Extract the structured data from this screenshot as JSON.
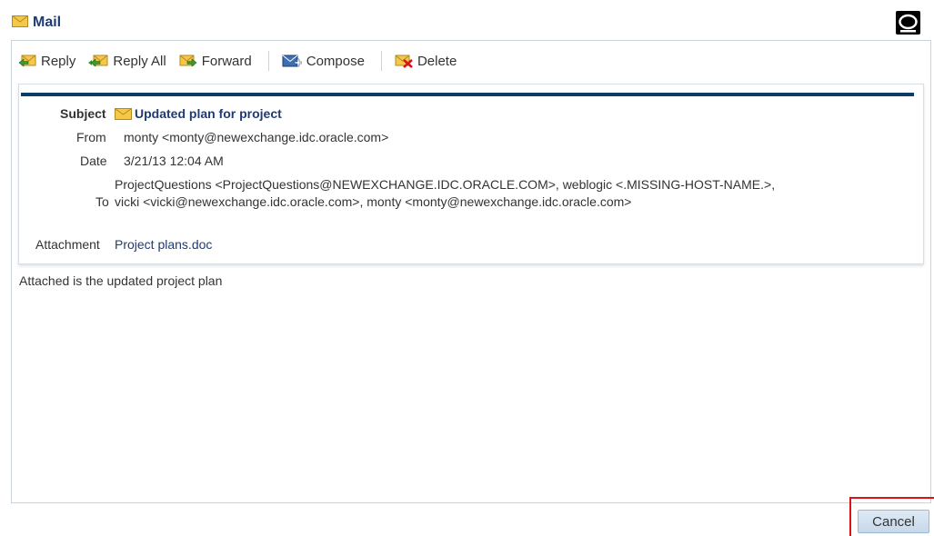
{
  "window": {
    "title": "Mail"
  },
  "toolbar": {
    "reply": "Reply",
    "reply_all": "Reply All",
    "forward": "Forward",
    "compose": "Compose",
    "delete": "Delete"
  },
  "message": {
    "subject_label": "Subject",
    "subject": "Updated plan for project",
    "from_label": "From",
    "from": "monty <monty@newexchange.idc.oracle.com>",
    "date_label": "Date",
    "date": "3/21/13 12:04 AM",
    "to_label": "To",
    "to_line1": "ProjectQuestions <ProjectQuestions@NEWEXCHANGE.IDC.ORACLE.COM>, weblogic <.MISSING-HOST-NAME.>,",
    "to_line2": "vicki <vicki@newexchange.idc.oracle.com>, monty  <monty@newexchange.idc.oracle.com>",
    "attachment_label": "Attachment",
    "attachment": "Project plans.doc",
    "body": "Attached is the updated project plan"
  },
  "footer": {
    "cancel": "Cancel"
  },
  "colors": {
    "title": "#1f3b73",
    "header_bar": "#0b3b66",
    "highlight": "#d9141b"
  },
  "icons": [
    "envelope-icon",
    "oracle-logo-icon",
    "reply-icon",
    "reply-all-icon",
    "forward-icon",
    "compose-icon",
    "delete-icon"
  ]
}
